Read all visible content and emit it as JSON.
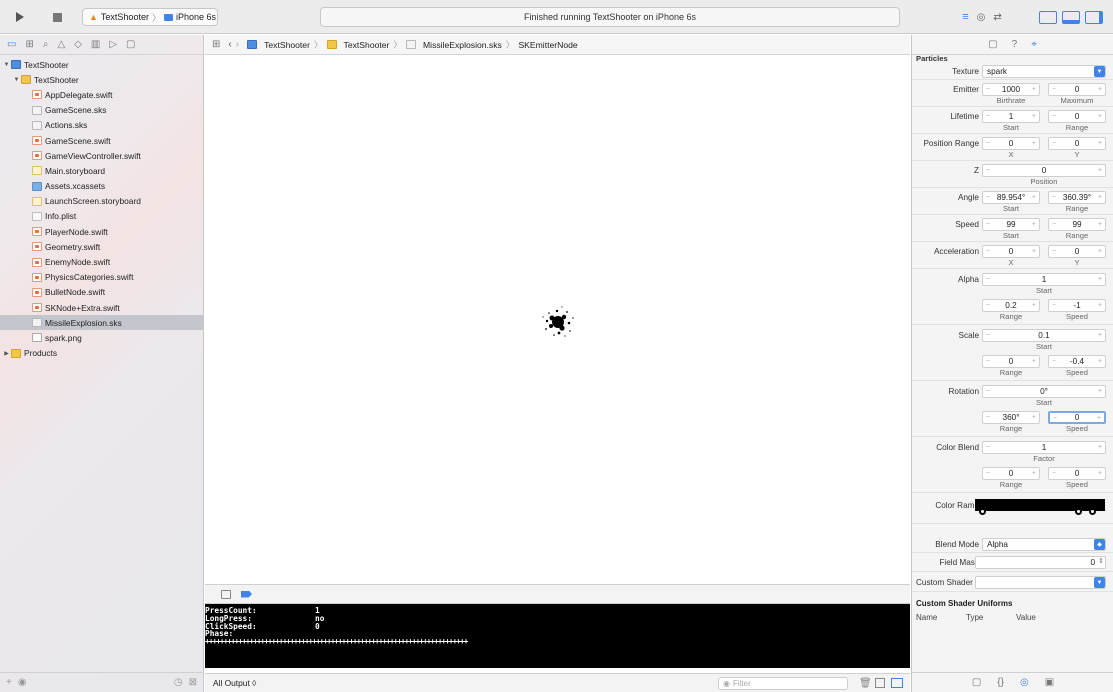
{
  "toolbar": {
    "scheme_app": "TextShooter",
    "scheme_device": "iPhone 6s",
    "status_text": "Finished running TextShooter on iPhone 6s",
    "icons": [
      "run-icon",
      "stop-icon",
      "editor-standard-icon",
      "editor-assistant-icon",
      "editor-version-icon",
      "toggle-navigator-icon",
      "toggle-debug-icon",
      "toggle-inspector-icon"
    ]
  },
  "navigator": {
    "project": "TextShooter",
    "group": "TextShooter",
    "files": [
      {
        "name": "AppDelegate.swift",
        "kind": "swift"
      },
      {
        "name": "GameScene.sks",
        "kind": "sks"
      },
      {
        "name": "Actions.sks",
        "kind": "sks"
      },
      {
        "name": "GameScene.swift",
        "kind": "swift"
      },
      {
        "name": "GameViewController.swift",
        "kind": "swift"
      },
      {
        "name": "Main.storyboard",
        "kind": "sb"
      },
      {
        "name": "Assets.xcassets",
        "kind": "assets"
      },
      {
        "name": "LaunchScreen.storyboard",
        "kind": "sb"
      },
      {
        "name": "Info.plist",
        "kind": "plist"
      },
      {
        "name": "PlayerNode.swift",
        "kind": "swift"
      },
      {
        "name": "Geometry.swift",
        "kind": "swift"
      },
      {
        "name": "EnemyNode.swift",
        "kind": "swift"
      },
      {
        "name": "PhysicsCategories.swift",
        "kind": "swift"
      },
      {
        "name": "BulletNode.swift",
        "kind": "swift"
      },
      {
        "name": "SKNode+Extra.swift",
        "kind": "swift"
      },
      {
        "name": "MissileExplosion.sks",
        "kind": "sks"
      },
      {
        "name": "spark.png",
        "kind": "png"
      }
    ],
    "selected_file": "MissileExplosion.sks",
    "products": "Products"
  },
  "jumpbar": {
    "crumbs": [
      "TextShooter",
      "TextShooter",
      "MissileExplosion.sks",
      "SKEmitterNode"
    ]
  },
  "console": {
    "lines": [
      {
        "key": "PressCount:",
        "value": "1"
      },
      {
        "key": "LongPress:",
        "value": "no"
      },
      {
        "key": "ClickSpeed:",
        "value": "0"
      },
      {
        "key": "Phase:",
        "value": ""
      }
    ],
    "separator": "+++++++++++++++++++++++++++++++++++++++++++++++++++++++++++++++++++++++",
    "output_selector": "All Output ◊",
    "filter_placeholder": "Filter"
  },
  "inspector": {
    "section": "Particles",
    "texture_label": "Texture",
    "texture_value": "spark",
    "emitter": {
      "label": "Emitter",
      "birthrate": "1000",
      "maximum": "0",
      "sub1": "Birthrate",
      "sub2": "Maximum"
    },
    "lifetime": {
      "label": "Lifetime",
      "start": "1",
      "range": "0",
      "sub1": "Start",
      "sub2": "Range"
    },
    "position_range": {
      "label": "Position Range",
      "x": "0",
      "y": "0",
      "sub1": "X",
      "sub2": "Y"
    },
    "z": {
      "label": "Z",
      "position": "0",
      "sub": "Position"
    },
    "angle": {
      "label": "Angle",
      "start": "89.954°",
      "range": "360.39°",
      "sub1": "Start",
      "sub2": "Range"
    },
    "speed": {
      "label": "Speed",
      "start": "99",
      "range": "99",
      "sub1": "Start",
      "sub2": "Range"
    },
    "acceleration": {
      "label": "Acceleration",
      "x": "0",
      "y": "0",
      "sub1": "X",
      "sub2": "Y"
    },
    "alpha": {
      "label": "Alpha",
      "start": "1",
      "range": "0.2",
      "speed": "-1",
      "sub_start": "Start",
      "sub1": "Range",
      "sub2": "Speed"
    },
    "scale": {
      "label": "Scale",
      "start": "0.1",
      "range": "0",
      "speed": "-0.4",
      "sub_start": "Start",
      "sub1": "Range",
      "sub2": "Speed"
    },
    "rotation": {
      "label": "Rotation",
      "start": "0°",
      "range": "360°",
      "speed": "0",
      "sub_start": "Start",
      "sub1": "Range",
      "sub2": "Speed"
    },
    "color_blend": {
      "label": "Color Blend",
      "factor": "1",
      "range": "0",
      "speed": "0",
      "sub_start": "Factor",
      "sub1": "Range",
      "sub2": "Speed"
    },
    "color_ramp_label": "Color Ramp",
    "blend_mode_label": "Blend Mode",
    "blend_mode_value": "Alpha",
    "field_mask_label": "Field Mask",
    "field_mask_value": "0",
    "custom_shader_label": "Custom Shader",
    "custom_shader_value": "",
    "uniforms_head": "Custom Shader Uniforms",
    "uniform_cols": [
      "Name",
      "Type",
      "Value"
    ]
  },
  "colors": {
    "accent": "#3f84e6",
    "selection": "#c3c6cc",
    "console_bg": "#000000"
  }
}
